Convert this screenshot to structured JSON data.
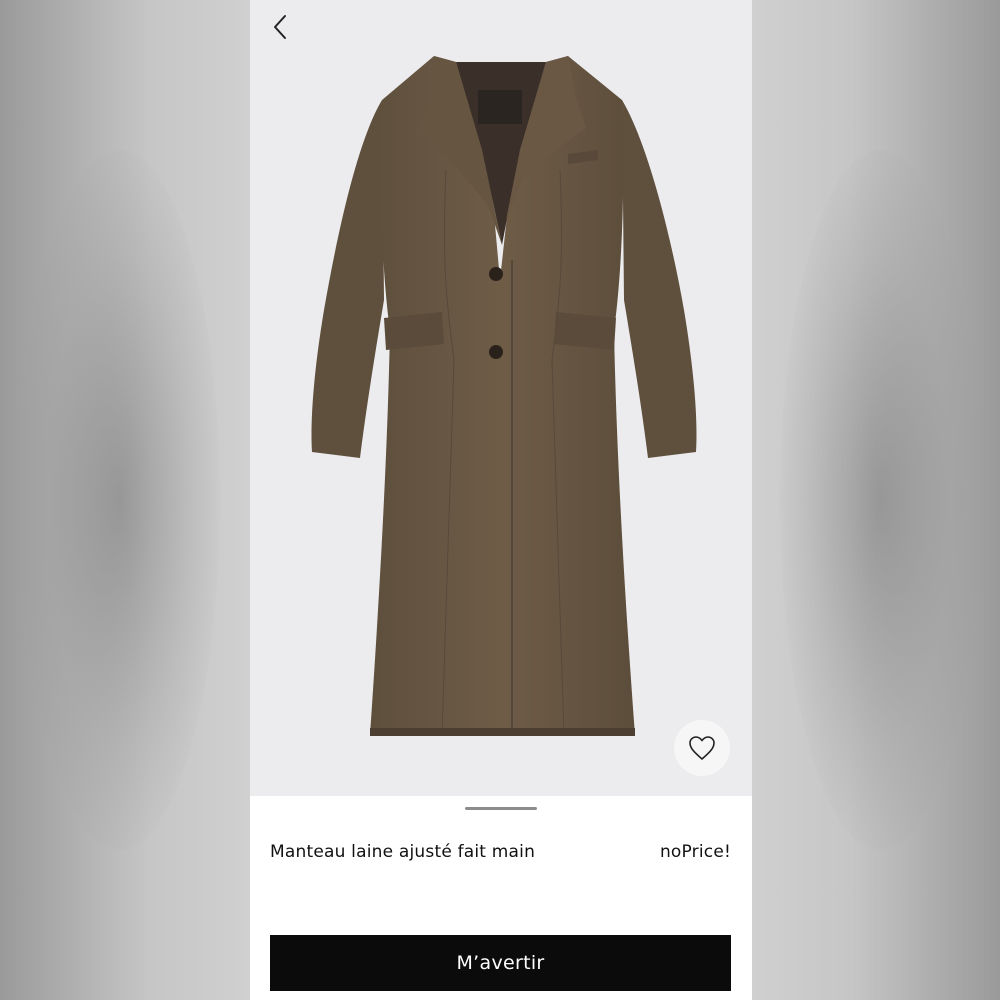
{
  "product": {
    "name": "Manteau laine ajusté fait main",
    "price": "noPrice!",
    "image_subject": "brown wool tailored long coat"
  },
  "actions": {
    "notify_label": "M’avertir"
  },
  "icons": {
    "back": "chevron-left-icon",
    "wishlist": "heart-outline-icon"
  },
  "colors": {
    "hero_background": "#ececee",
    "coat": "#6b5a45",
    "button_background": "#0b0b0c",
    "button_text": "#ffffff"
  }
}
